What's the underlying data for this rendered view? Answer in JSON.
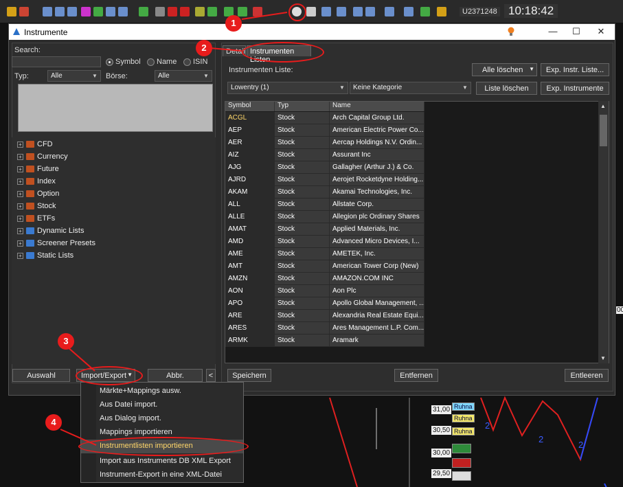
{
  "toolbar": {
    "account": "U2371248",
    "clock": "10:18:42"
  },
  "dialog": {
    "title": "Instrumente",
    "window_controls": {
      "minimize": "—",
      "maximize": "☐",
      "close": "✕"
    }
  },
  "left": {
    "search_label": "Search:",
    "search_value": "",
    "radio_options": [
      "Symbol",
      "Name",
      "ISIN"
    ],
    "radio_selected": "Symbol",
    "typ_label": "Typ:",
    "typ_value": "Alle",
    "boerse_label": "Börse:",
    "boerse_value": "Alle",
    "tree": [
      "CFD",
      "Currency",
      "Future",
      "Index",
      "Option",
      "Stock",
      "ETFs",
      "Dynamic Lists",
      "Screener Presets",
      "Static Lists"
    ],
    "buttons": {
      "auswahl": "Auswahl",
      "import_export": "Import/Export",
      "abbr": "Abbr.",
      "collapse": "<"
    }
  },
  "right": {
    "tabs": [
      "Details",
      "Instrumenten Listen"
    ],
    "active_tab": "Instrumenten Listen",
    "list_label": "Instrumenten Liste:",
    "list_value": "Lowentry (1)",
    "category_value": "Keine Kategorie",
    "buttons": {
      "alle_loeschen": "Alle löschen",
      "exp_instr_liste": "Exp. Instr. Liste...",
      "liste_loeschen": "Liste löschen",
      "exp_instrumente": "Exp. Instrumente",
      "speichern": "Speichern",
      "entfernen": "Entfernen",
      "entleeren": "Entleeren"
    },
    "grid_headers": [
      "Symbol",
      "Typ",
      "Name"
    ],
    "rows": [
      [
        "ACGL",
        "Stock",
        "Arch Capital Group Ltd."
      ],
      [
        "AEP",
        "Stock",
        "American Electric Power Co..."
      ],
      [
        "AER",
        "Stock",
        "Aercap Holdings N.V. Ordin..."
      ],
      [
        "AIZ",
        "Stock",
        "Assurant Inc"
      ],
      [
        "AJG",
        "Stock",
        "Gallagher (Arthur J.) & Co."
      ],
      [
        "AJRD",
        "Stock",
        "Aerojet Rocketdyne Holding..."
      ],
      [
        "AKAM",
        "Stock",
        "Akamai Technologies, Inc."
      ],
      [
        "ALL",
        "Stock",
        "Allstate Corp."
      ],
      [
        "ALLE",
        "Stock",
        "Allegion plc Ordinary Shares"
      ],
      [
        "AMAT",
        "Stock",
        "Applied Materials, Inc."
      ],
      [
        "AMD",
        "Stock",
        "Advanced Micro Devices, I..."
      ],
      [
        "AME",
        "Stock",
        "AMETEK, Inc."
      ],
      [
        "AMT",
        "Stock",
        "American Tower Corp (New)"
      ],
      [
        "AMZN",
        "Stock",
        "AMAZON.COM INC"
      ],
      [
        "AON",
        "Stock",
        "Aon Plc"
      ],
      [
        "APO",
        "Stock",
        "Apollo Global Management, ..."
      ],
      [
        "ARE",
        "Stock",
        "Alexandria Real Estate Equi..."
      ],
      [
        "ARES",
        "Stock",
        "Ares Management L.P. Com..."
      ],
      [
        "ARMK",
        "Stock",
        "Aramark"
      ]
    ]
  },
  "menu": {
    "items": [
      "Märkte+Mappings ausw.",
      "Aus Datei import.",
      "Aus Dialog import.",
      "Mappings importieren",
      "Instrumentlisten importieren",
      "Import aus Instruments DB XML Export",
      "Instrument-Export in eine XML-Datei"
    ],
    "highlighted": "Instrumentlisten importieren"
  },
  "callouts": [
    "1",
    "2",
    "3",
    "4"
  ],
  "chart": {
    "prices": [
      "31,00",
      "30,50",
      "30,00",
      "29,50"
    ],
    "pill_label": "Ruhna",
    "wave_label": "2",
    "edge_label": "00"
  },
  "colors": {
    "accent_red": "#e81c1c",
    "highlight_text": "#ffd76a"
  }
}
